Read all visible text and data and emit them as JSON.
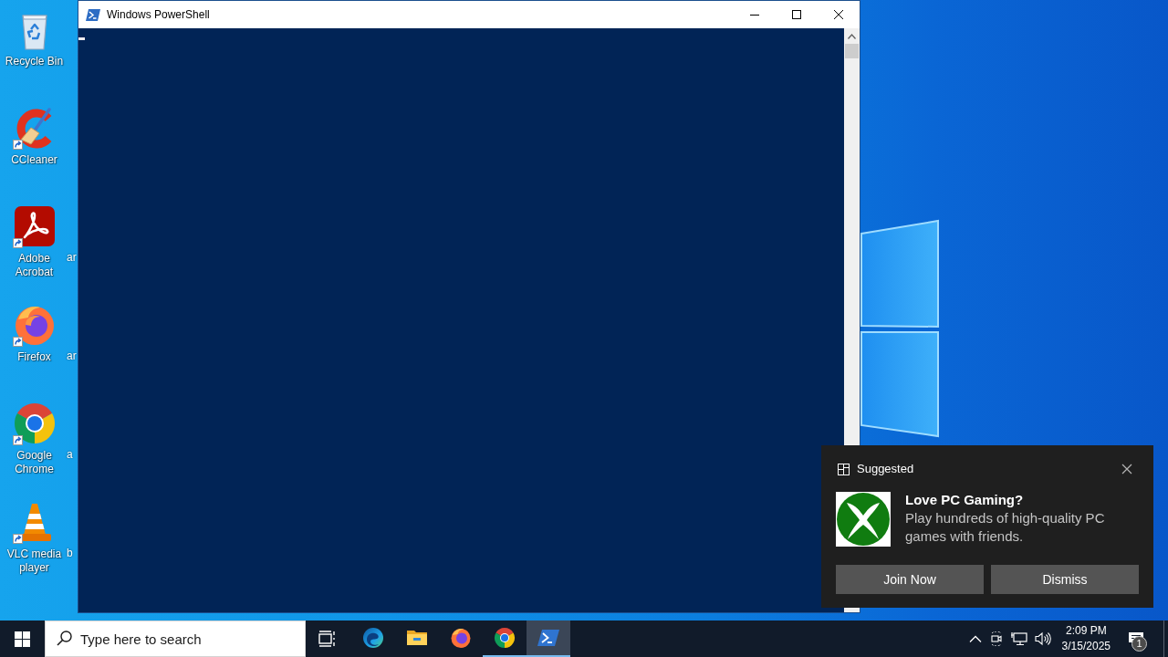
{
  "desktop": {
    "icons": [
      {
        "kind": "recycle-bin",
        "label": "Recycle Bin",
        "shortcut": false
      },
      {
        "kind": "ccleaner",
        "label": "CCleaner",
        "shortcut": true
      },
      {
        "kind": "acrobat",
        "label": "Adobe Acrobat",
        "shortcut": true
      },
      {
        "kind": "firefox",
        "label": "Firefox",
        "shortcut": true
      },
      {
        "kind": "chrome",
        "label": "Google Chrome",
        "shortcut": true
      },
      {
        "kind": "vlc",
        "label": "VLC media player",
        "shortcut": true
      }
    ],
    "covered_icon_labels": [
      "ar",
      "ar",
      "a",
      "b"
    ]
  },
  "window": {
    "title": "Windows PowerShell"
  },
  "notification": {
    "header": "Suggested",
    "title": "Love PC Gaming?",
    "message": "Play hundreds of high-quality PC games with friends.",
    "buttons": [
      "Join Now",
      "Dismiss"
    ]
  },
  "taskbar": {
    "search": {
      "placeholder": "Type here to search"
    },
    "apps": [
      {
        "kind": "edge",
        "running": false,
        "active": false
      },
      {
        "kind": "explorer",
        "running": false,
        "active": false
      },
      {
        "kind": "firefox",
        "running": false,
        "active": false
      },
      {
        "kind": "chrome",
        "running": true,
        "active": false
      },
      {
        "kind": "powershell",
        "running": true,
        "active": true
      }
    ],
    "tray": {
      "time": "2:09 PM",
      "date": "3/15/2025",
      "notification_count": "1"
    }
  }
}
